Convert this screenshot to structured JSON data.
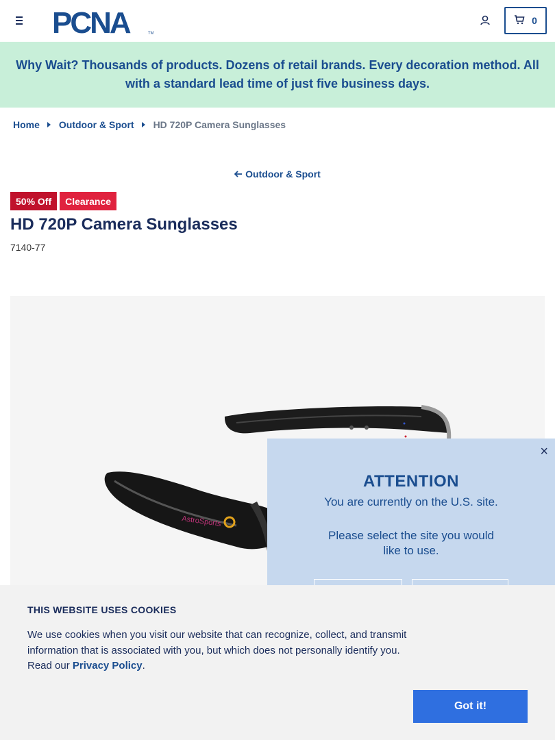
{
  "header": {
    "logo_text": "PCNA",
    "logo_tm": "TM",
    "cart_count": "0"
  },
  "promo": {
    "text": "Why Wait? Thousands of products. Dozens of retail brands. Every decoration method. All with a standard lead time of just five business days."
  },
  "breadcrumb": {
    "items": [
      "Home",
      "Outdoor & Sport"
    ],
    "current": "HD 720P Camera Sunglasses"
  },
  "back_link": {
    "label": "Outdoor & Sport"
  },
  "product": {
    "badges": [
      "50% Off",
      "Clearance"
    ],
    "title": "HD 720P Camera Sunglasses",
    "sku": "7140-77",
    "imprint_text": "AstroSports"
  },
  "modal": {
    "heading": "ATTENTION",
    "line1": "You are currently on the U.S. site.",
    "line2": "Please select the site you would",
    "line3": "like to use.",
    "close": "×"
  },
  "cookies": {
    "title": "THIS WEBSITE USES COOKIES",
    "text": "We use cookies when you visit our website that can recognize, collect, and transmit information that is associated with you, but which does not personally identify you. Read our ",
    "link": "Privacy Policy",
    "period": ".",
    "button": "Got it!"
  },
  "colors": {
    "brand_blue": "#1a4d8f",
    "navy": "#1a2c5b",
    "promo_bg": "#c8efd9",
    "sale_red": "#c0122c",
    "cookie_btn": "#2f6fe0",
    "modal_bg": "#c6d8ee"
  },
  "icons": {
    "menu": "hamburger-icon",
    "account": "user-icon",
    "cart": "cart-icon",
    "breadcrumb_sep": "caret-right-icon",
    "back": "arrow-left-icon",
    "close": "close-icon"
  }
}
